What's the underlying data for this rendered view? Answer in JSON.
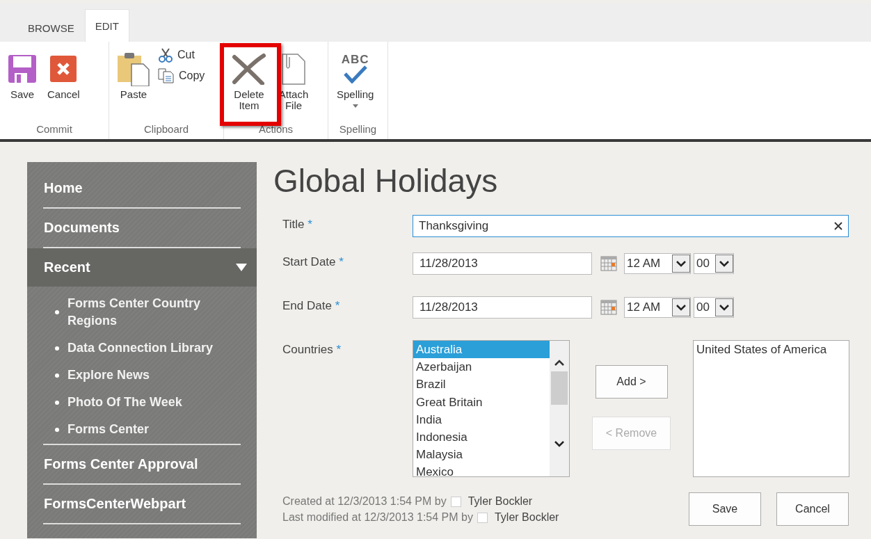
{
  "ribbon": {
    "tabs": [
      {
        "label": "BROWSE",
        "selected": false
      },
      {
        "label": "EDIT",
        "selected": true
      }
    ],
    "groups": [
      {
        "label": "Commit",
        "buttons": [
          {
            "kind": "save",
            "label": "Save"
          },
          {
            "kind": "cancel",
            "label": "Cancel"
          }
        ]
      },
      {
        "label": "Clipboard",
        "buttons": [
          {
            "kind": "paste",
            "label": "Paste"
          },
          {
            "kind": "cut",
            "label": "Cut"
          },
          {
            "kind": "copy",
            "label": "Copy"
          }
        ]
      },
      {
        "label": "Actions",
        "buttons": [
          {
            "kind": "delete",
            "label": "Delete Item",
            "highlighted": true
          },
          {
            "kind": "attach",
            "label": "Attach File",
            "highlighted": false
          }
        ]
      },
      {
        "label": "Spelling",
        "buttons": [
          {
            "kind": "spelling",
            "label": "Spelling",
            "icon_text": "ABC",
            "dropdown": true
          }
        ]
      }
    ]
  },
  "nav": {
    "items": [
      {
        "label": "Home",
        "selected": false
      },
      {
        "label": "Documents",
        "selected": false
      },
      {
        "label": "Recent",
        "selected": true,
        "expanded": true,
        "children": [
          {
            "label": "Forms Center Country Regions"
          },
          {
            "label": "Data Connection Library"
          },
          {
            "label": "Explore News"
          },
          {
            "label": "Photo Of The Week"
          },
          {
            "label": "Forms Center"
          }
        ]
      },
      {
        "label": "Forms Center Approval",
        "selected": false
      },
      {
        "label": "FormsCenterWebpart",
        "selected": false
      }
    ]
  },
  "page": {
    "title": "Global Holidays"
  },
  "form": {
    "fields": [
      {
        "kind": "text",
        "label": "Title",
        "required_mark": "*",
        "value": "Thanksgiving",
        "focused": true
      },
      {
        "kind": "datetime",
        "label": "Start Date",
        "required_mark": "*",
        "date": "11/28/2013",
        "hour": "12 AM",
        "minute": "00"
      },
      {
        "kind": "datetime",
        "label": "End Date",
        "required_mark": "*",
        "date": "11/28/2013",
        "hour": "12 AM",
        "minute": "00"
      },
      {
        "kind": "picker",
        "label": "Countries",
        "required_mark": "*",
        "available": [
          {
            "label": "Australia",
            "selected": true
          },
          {
            "label": "Azerbaijan",
            "selected": false
          },
          {
            "label": "Brazil",
            "selected": false
          },
          {
            "label": "Great Britain",
            "selected": false
          },
          {
            "label": "India",
            "selected": false
          },
          {
            "label": "Indonesia",
            "selected": false
          },
          {
            "label": "Malaysia",
            "selected": false
          },
          {
            "label": "Mexico",
            "selected": false
          }
        ],
        "add_button": {
          "label": "Add >",
          "disabled": false
        },
        "remove_button": {
          "label": "< Remove",
          "disabled": true
        },
        "chosen": [
          {
            "label": "United States of America",
            "selected": false
          }
        ]
      }
    ],
    "footer": [
      {
        "text": "Created at 12/3/2013 1:54 PM  by",
        "author": "Tyler Bockler"
      },
      {
        "text": "Last modified at 12/3/2013 1:54 PM  by",
        "author": "Tyler Bockler"
      }
    ],
    "buttons": [
      "Save",
      "Cancel"
    ]
  }
}
